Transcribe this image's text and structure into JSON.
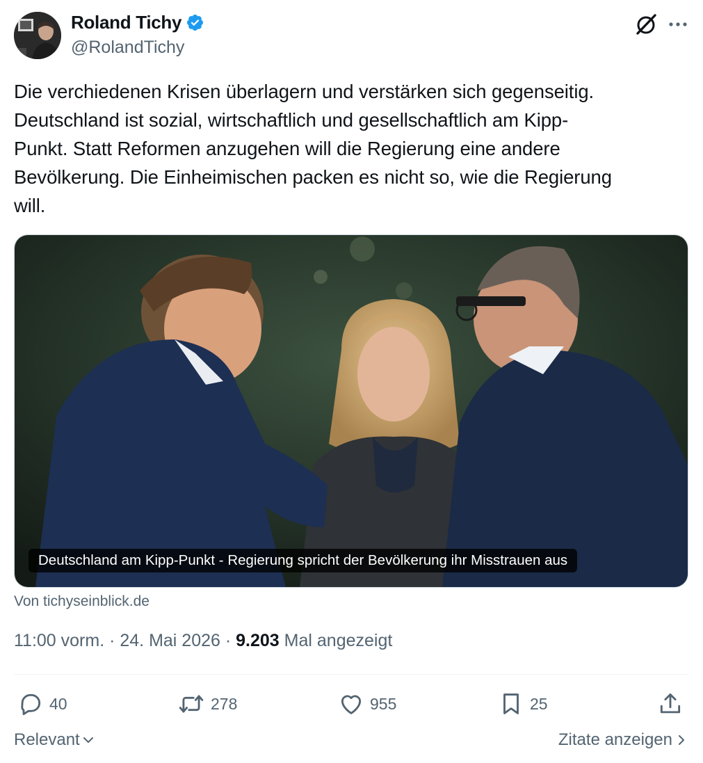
{
  "author": {
    "name": "Roland Tichy",
    "handle": "@RolandTichy"
  },
  "tweet": {
    "text": "Die verchiedenen Krisen überlagern und verstärken sich gegenseitig.\nDeutschland ist sozial, wirtschaftlich und gesellschaftlich am Kipp-\nPunkt. Statt Reformen anzugehen will die Regierung eine andere\nBevölkerung. Die Einheimischen packen es nicht so, wie die Regierung\nwill."
  },
  "card": {
    "caption": "Deutschland am Kipp-Punkt - Regierung spricht der Bevölkerung ihr Misstrauen aus",
    "source": "Von tichyseinblick.de"
  },
  "meta": {
    "time": "11:00 vorm.",
    "separator": " · ",
    "date": "24. Mai 2026",
    "views_count": "9.203",
    "views_label": "Mal angezeigt"
  },
  "actions": {
    "replies": "40",
    "reposts": "278",
    "likes": "955",
    "bookmarks": "25"
  },
  "footer": {
    "sort_label": "Relevant",
    "quotes_label": "Zitate anzeigen"
  },
  "icons": {
    "verified": "verified-badge-icon",
    "grok": "grok-icon",
    "more": "more-dots-icon",
    "reply": "reply-icon",
    "repost": "repost-icon",
    "like": "heart-icon",
    "bookmark": "bookmark-icon",
    "share": "share-icon"
  },
  "colors": {
    "verified_blue": "#1d9bf0",
    "text_primary": "#0f1419",
    "text_secondary": "#536471"
  }
}
